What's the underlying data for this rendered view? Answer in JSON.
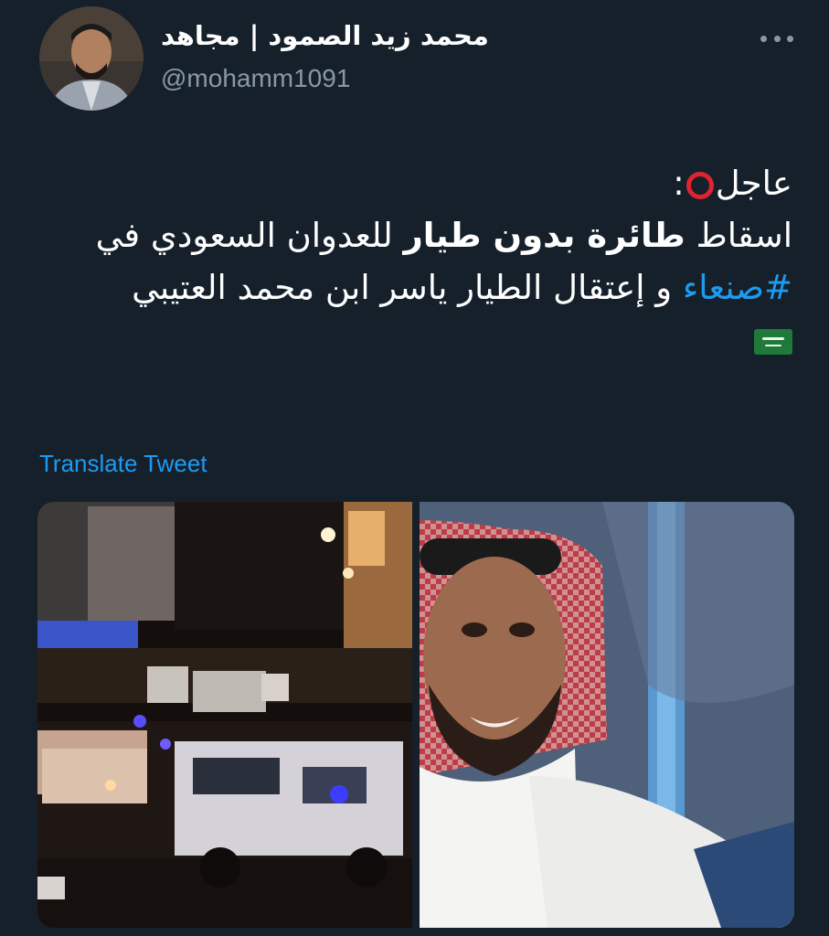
{
  "author": {
    "name": "محمد زيد الصمود | مجاهد",
    "handle": "@mohamm1091"
  },
  "tweet": {
    "line1_text": "عاجل",
    "line1_suffix": ":",
    "line2_prefix": "اسقاط ",
    "line2_bold": "طائرة بدون طيار",
    "line2_suffix": " للعدوان السعودي في",
    "line3_hashtag": "#صنعاء",
    "line3_suffix": " و إعتقال الطيار ياسر ابن محمد العتيبي",
    "emoji_alert": "red-circle-emoji",
    "emoji_flag": "saudi-flag-emoji"
  },
  "translate_label": "Translate Tweet",
  "colors": {
    "background": "#15202b",
    "link": "#1d9bf0",
    "secondary_text": "#8899a6",
    "alert_red": "#e0242f"
  }
}
